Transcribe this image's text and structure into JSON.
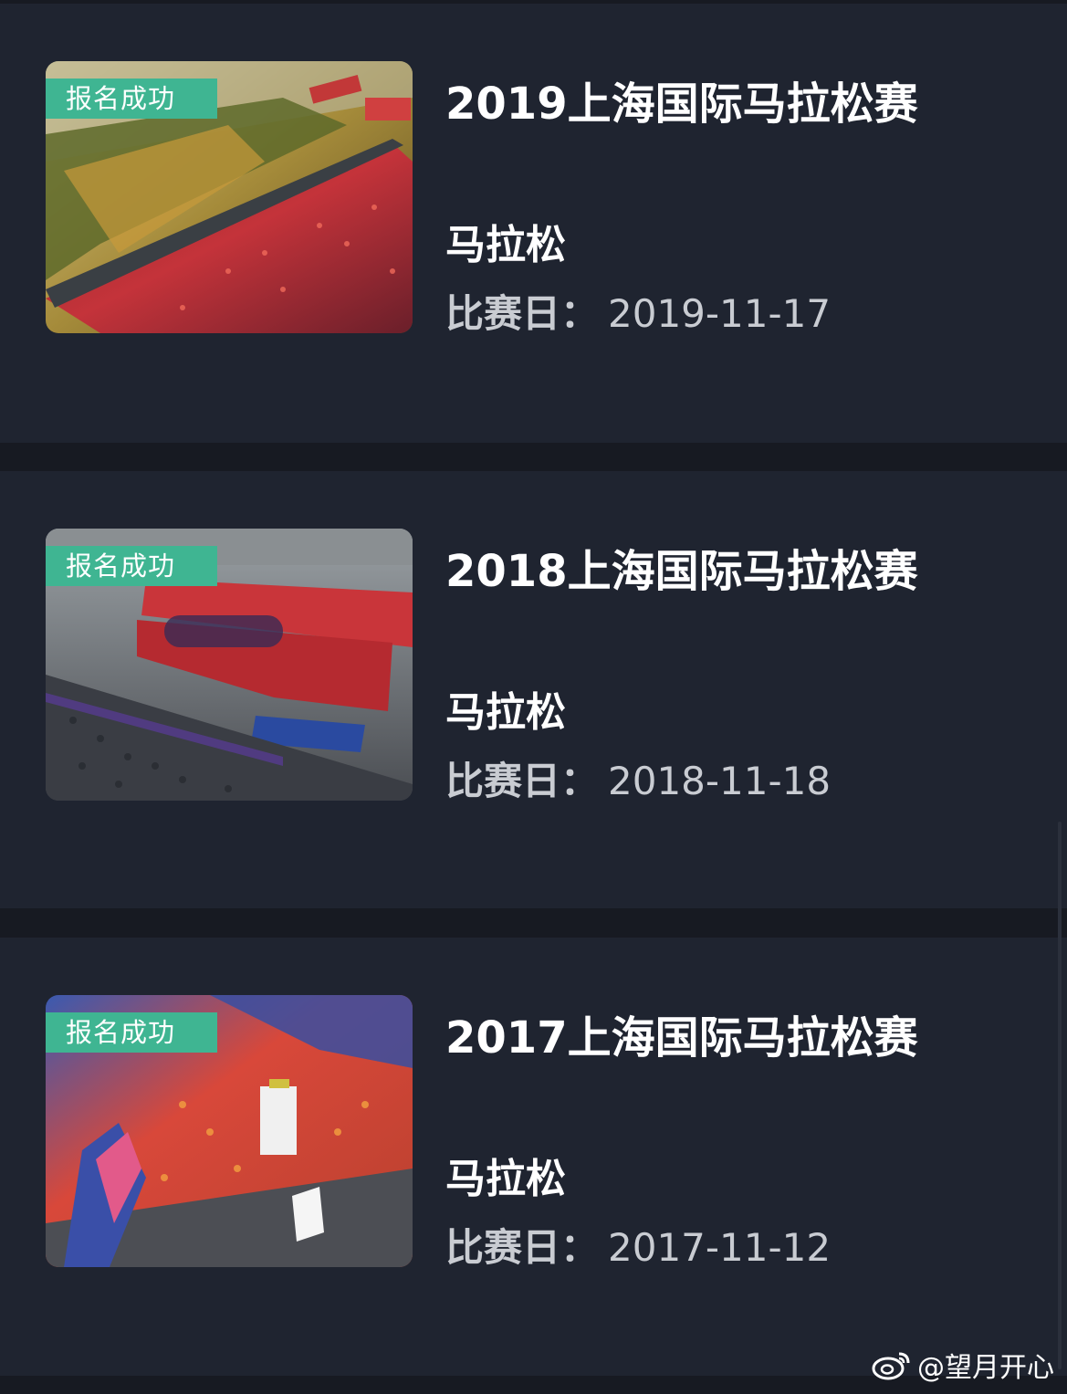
{
  "events": [
    {
      "badge": "报名成功",
      "title": "2019上海国际马拉松赛",
      "category": "马拉松",
      "date_label": "比赛日：",
      "date_value": "2019-11-17"
    },
    {
      "badge": "报名成功",
      "title": "2018上海国际马拉松赛",
      "category": "马拉松",
      "date_label": "比赛日：",
      "date_value": "2018-11-18"
    },
    {
      "badge": "报名成功",
      "title": "2017上海国际马拉松赛",
      "category": "马拉松",
      "date_label": "比赛日：",
      "date_value": "2017-11-12"
    }
  ],
  "watermark": "@望月开心",
  "colors": {
    "background": "#171a22",
    "card": "#1f2430",
    "badge": "#3fb592"
  }
}
